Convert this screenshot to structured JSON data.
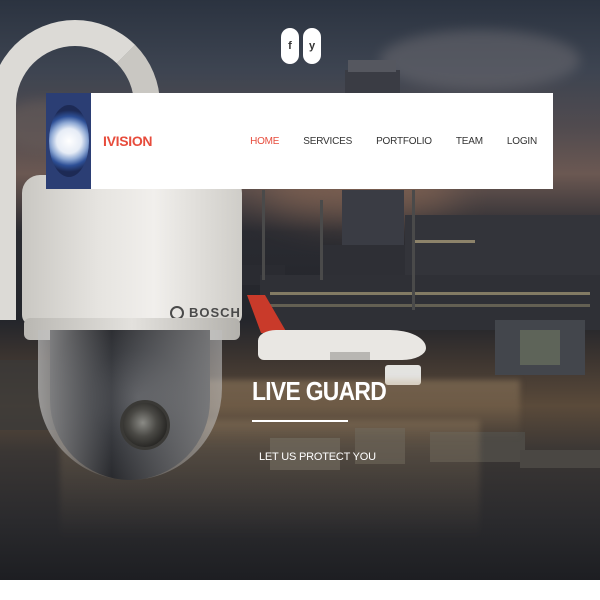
{
  "social": {
    "items": [
      {
        "name": "facebook",
        "glyph": "f"
      },
      {
        "name": "twitter",
        "glyph": "y"
      }
    ]
  },
  "navbar": {
    "brand": "IVISION",
    "links": [
      {
        "label": "HOME",
        "active": true
      },
      {
        "label": "SERVICES",
        "active": false
      },
      {
        "label": "PORTFOLIO",
        "active": false
      },
      {
        "label": "TEAM",
        "active": false
      },
      {
        "label": "LOGIN",
        "active": false
      }
    ]
  },
  "camera": {
    "brand_text": "BOSCH"
  },
  "hero": {
    "title": "LIVE GUARD",
    "subtitle": "LET US PROTECT YOU"
  },
  "colors": {
    "accent": "#e74c3c",
    "logo_bg": "#2b3e74",
    "text_white": "#ffffff"
  }
}
